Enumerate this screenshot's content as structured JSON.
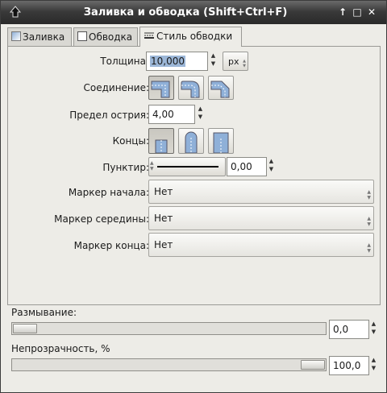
{
  "window": {
    "title": "Заливка и обводка (Shift+Ctrl+F)",
    "buttons": {
      "shade": "↑",
      "maximize": "□",
      "close": "✕"
    }
  },
  "tabs": [
    {
      "label": "Заливка",
      "icon": "fill-swatch-icon",
      "active": false
    },
    {
      "label": "Обводка",
      "icon": "stroke-swatch-icon",
      "active": false
    },
    {
      "label": "Стиль обводки",
      "icon": "stroke-style-icon",
      "active": true
    }
  ],
  "stroke_style": {
    "width": {
      "label": "Толщина:",
      "value": "10,000",
      "unit": "px"
    },
    "join": {
      "label": "Соединение:",
      "options": [
        "miter-join",
        "round-join",
        "bevel-join"
      ],
      "selected": "miter-join"
    },
    "miter_limit": {
      "label": "Предел острия:",
      "value": "4,00"
    },
    "caps": {
      "label": "Концы:",
      "options": [
        "butt-cap",
        "round-cap",
        "square-cap"
      ],
      "selected": "butt-cap"
    },
    "dash": {
      "label": "Пунктир:",
      "offset": "0,00"
    },
    "marker_start": {
      "label": "Маркер начала:",
      "value": "Нет"
    },
    "marker_mid": {
      "label": "Маркер середины:",
      "value": "Нет"
    },
    "marker_end": {
      "label": "Маркер конца:",
      "value": "Нет"
    }
  },
  "blur": {
    "label": "Размывание:",
    "value": "0,0",
    "level": 0.0
  },
  "opacity": {
    "label": "Непрозрачность, %",
    "value": "100,0",
    "level": 1.0
  },
  "colors": {
    "titlebar": "#3a3a3a",
    "selection": "#9cb7d8",
    "panel": "#edece7",
    "icon_fill": "#8fb0d8"
  }
}
